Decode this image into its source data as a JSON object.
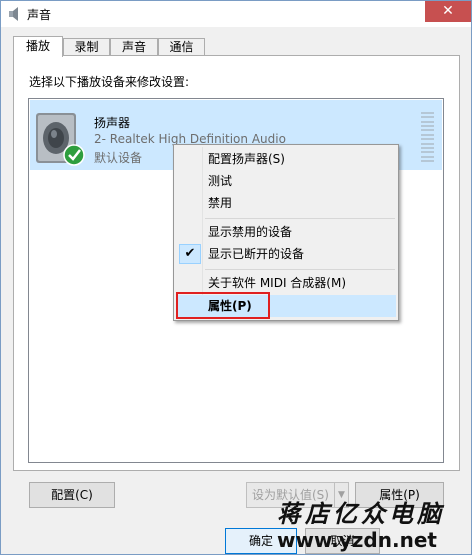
{
  "window": {
    "title": "声音",
    "close_glyph": "✕"
  },
  "tabs": [
    {
      "label": "播放",
      "active": true
    },
    {
      "label": "录制",
      "active": false
    },
    {
      "label": "声音",
      "active": false
    },
    {
      "label": "通信",
      "active": false
    }
  ],
  "panel": {
    "instructions": "选择以下播放设备来修改设置:"
  },
  "device": {
    "name": "扬声器",
    "description": "2- Realtek High Definition Audio",
    "status": "默认设备",
    "icon": "speaker-icon",
    "badge_icon": "green-check-icon"
  },
  "context_menu": {
    "items": [
      {
        "label": "配置扬声器(S)"
      },
      {
        "label": "测试"
      },
      {
        "label": "禁用"
      },
      {
        "label": "显示禁用的设备"
      },
      {
        "label": "显示已断开的设备",
        "checked": true
      },
      {
        "label": "关于软件 MIDI 合成器(M)"
      },
      {
        "label": "属性(P)",
        "bold": true,
        "highlighted": true
      }
    ]
  },
  "buttons": {
    "configure": "配置(C)",
    "set_default": "设为默认值(S)",
    "properties": "属性(P)",
    "ok": "确定",
    "cancel": "取消"
  },
  "watermark": {
    "line1": "蒋店亿众电脑",
    "line2": "www.yzdn.net"
  },
  "colors": {
    "selection": "#cce8ff",
    "highlight_box": "#e02020",
    "close_button": "#c75050"
  }
}
